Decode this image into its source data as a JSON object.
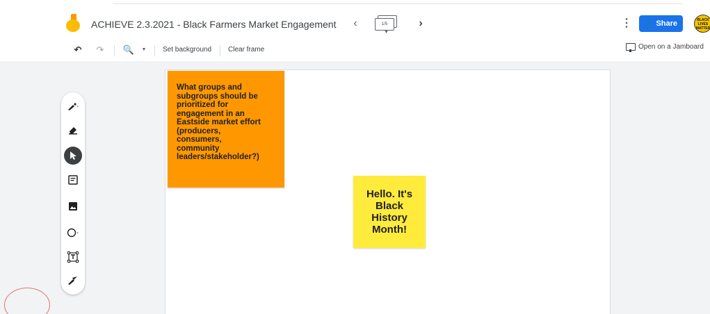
{
  "header": {
    "doc_title": "ACHIEVE 2.3.2021 - Black Farmers Market Engagement",
    "frame_indicator": "1/5",
    "share_label": "Share",
    "avatar_text": "BLACK LIVES MATTER"
  },
  "toolbar": {
    "set_background": "Set background",
    "clear_frame": "Clear frame",
    "open_on_jamboard": "Open on a Jamboard"
  },
  "tools": {
    "items": [
      "pen-icon",
      "eraser-icon",
      "select-icon",
      "sticky-note-icon",
      "image-icon",
      "shape-icon",
      "text-box-icon",
      "laser-icon"
    ]
  },
  "notes": {
    "orange": {
      "lines": [
        "What groups and",
        "subgroups should be",
        "prioritized for",
        "engagement in an",
        "Eastside market effort",
        "(producers,",
        "consumers,",
        "community",
        "leaders/stakeholder?)"
      ],
      "color": "#ff9800"
    },
    "yellow": {
      "lines": [
        "Hello. It's",
        "Black",
        "History",
        "Month!"
      ],
      "color": "#ffeb3b"
    }
  },
  "colors": {
    "accent": "#1a73e8",
    "background": "#f1f3f4"
  }
}
